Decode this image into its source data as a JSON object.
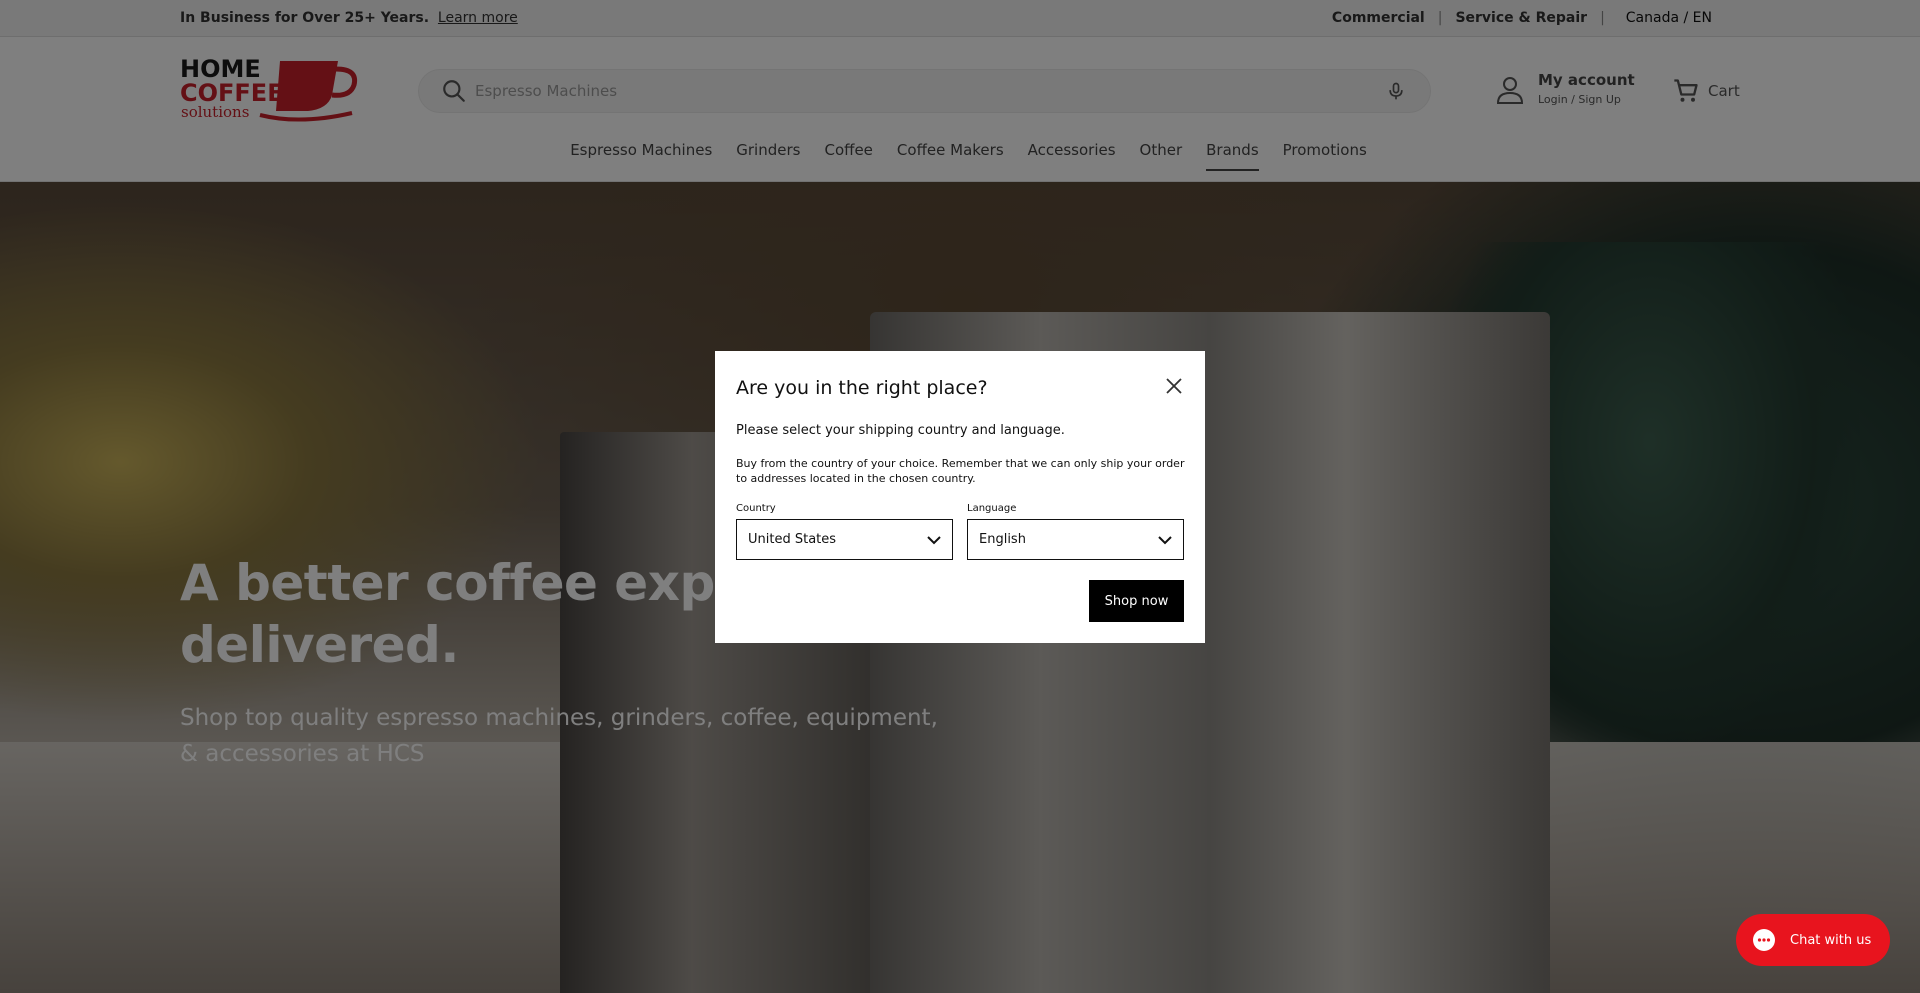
{
  "topbar": {
    "announcement": "In Business for Over 25+ Years.",
    "learn_more": "Learn more",
    "links": [
      "Commercial",
      "Service & Repair"
    ],
    "locale": "Canada / EN"
  },
  "header": {
    "logo_line1": "HOME",
    "logo_line2": "COFFEE",
    "logo_line3": "solutions",
    "search_placeholder": "Espresso Machines",
    "account_title": "My account",
    "account_sub": "Login / Sign Up",
    "cart_label": "Cart"
  },
  "nav": {
    "items": [
      "Espresso Machines",
      "Grinders",
      "Coffee",
      "Coffee Makers",
      "Accessories",
      "Other",
      "Brands",
      "Promotions"
    ],
    "active": "Brands"
  },
  "hero": {
    "headline": "A better coffee experience, delivered.",
    "sub": "Shop top quality espresso machines, grinders, coffee, equipment, & accessories at HCS"
  },
  "modal": {
    "title": "Are you in the right place?",
    "p1": "Please select your shipping country and language.",
    "p2": "Buy from the country of your choice. Remember that we can only ship your order to addresses located in the chosen country.",
    "country_label": "Country",
    "country_value": "United States",
    "language_label": "Language",
    "language_value": "English",
    "submit_label": "Shop now"
  },
  "chat": {
    "label": "Chat with us"
  },
  "colors": {
    "brand_red": "#c8202b",
    "chat_red": "#e8141e"
  }
}
